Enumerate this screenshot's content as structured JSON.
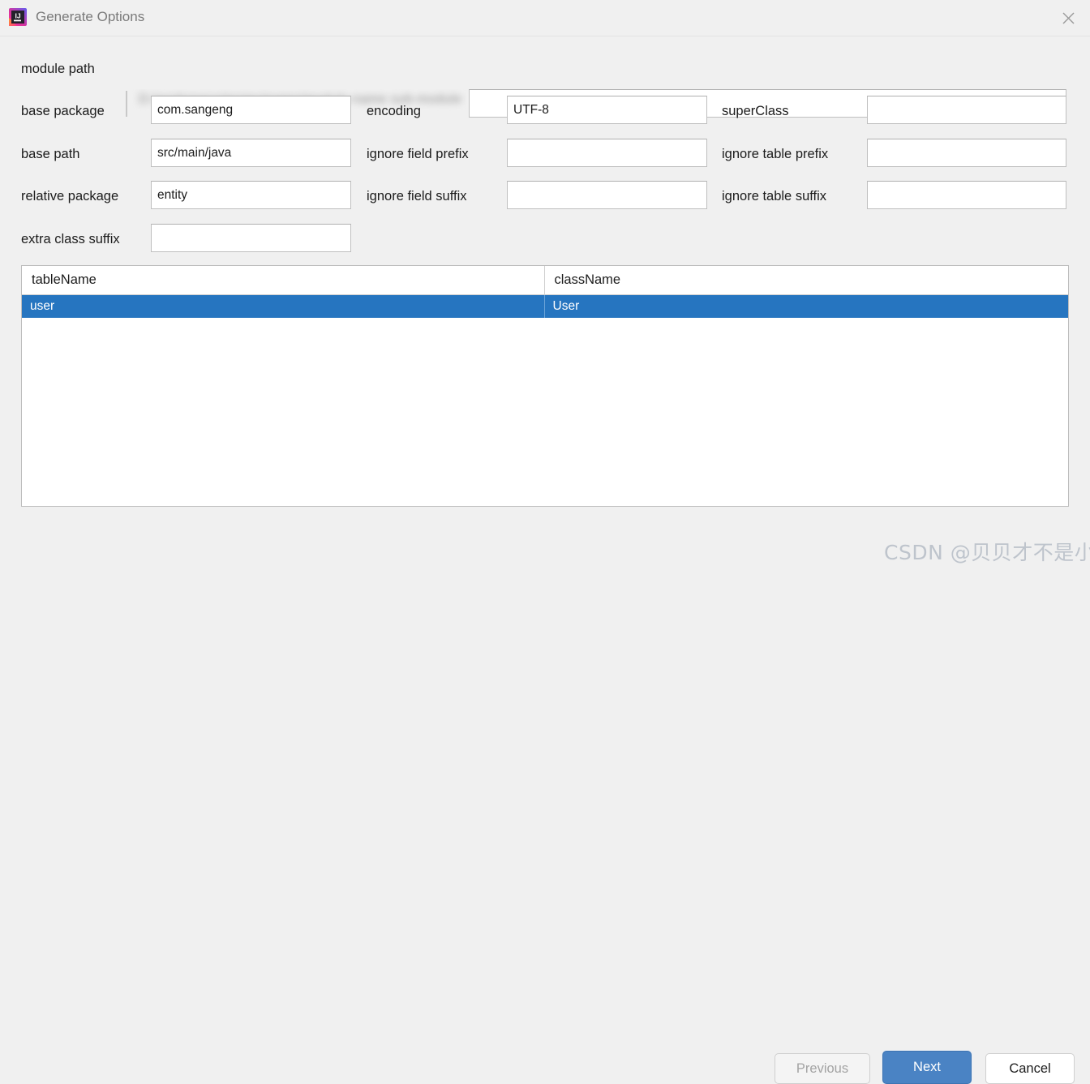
{
  "window": {
    "title": "Generate Options",
    "app_icon": "intellij-idea-icon",
    "close_icon": "close-icon"
  },
  "form": {
    "module_path": {
      "label": "module path",
      "redacted_value": "D:/workspace/projectname/module-name   sub-module",
      "input_value": "",
      "placeholder": ""
    },
    "rows": [
      {
        "left": {
          "label": "base package",
          "value": "com.sangeng",
          "name": "base-package"
        },
        "middle": {
          "label": "encoding",
          "value": "UTF-8",
          "name": "encoding"
        },
        "right": {
          "label": "superClass",
          "value": "",
          "name": "super-class"
        }
      },
      {
        "left": {
          "label": "base path",
          "value": "src/main/java",
          "name": "base-path"
        },
        "middle": {
          "label": "ignore field prefix",
          "value": "",
          "name": "ignore-field-prefix"
        },
        "right": {
          "label": "ignore table prefix",
          "value": "",
          "name": "ignore-table-prefix"
        }
      },
      {
        "left": {
          "label": "relative package",
          "value": "entity",
          "name": "relative-package"
        },
        "middle": {
          "label": "ignore field suffix",
          "value": "",
          "name": "ignore-field-suffix"
        },
        "right": {
          "label": "ignore table suffix",
          "value": "",
          "name": "ignore-table-suffix"
        }
      }
    ],
    "extra_class_suffix": {
      "label": "extra class suffix",
      "value": ""
    }
  },
  "table": {
    "columns": [
      "tableName",
      "className"
    ],
    "rows": [
      {
        "tableName": "user",
        "className": "User",
        "selected": true
      }
    ]
  },
  "buttons": {
    "previous": "Previous",
    "next": "Next",
    "cancel": "Cancel"
  },
  "watermark": "CSDN @贝贝才不是小淘气",
  "colors": {
    "dialog_background": "#f0f0f0",
    "selection_blue": "#2675c0",
    "primary_button_blue": "#4a83c4",
    "disabled_text": "#a3a3a3",
    "title_text": "#7a7a7a"
  }
}
